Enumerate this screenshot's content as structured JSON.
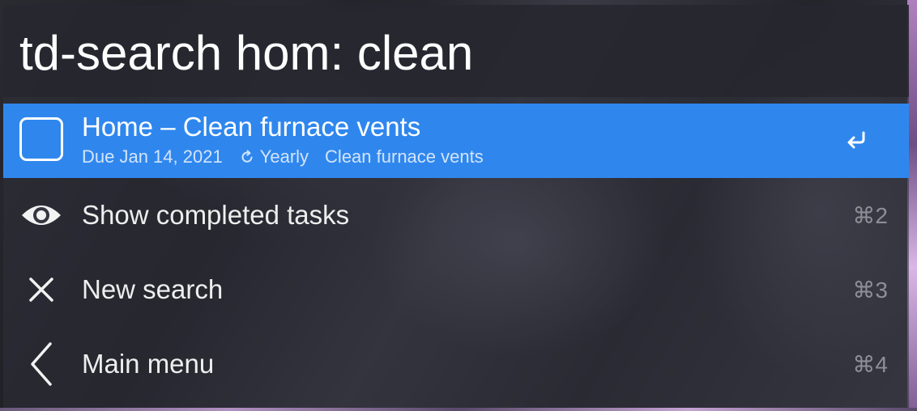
{
  "search": {
    "query": "td-search hom: clean"
  },
  "results": [
    {
      "title": "Home – Clean furnace vents",
      "due": "Due Jan 14, 2021",
      "recurrence": "Yearly",
      "note": "Clean furnace vents",
      "icon": "checkbox-icon",
      "action_icon": "return-icon"
    },
    {
      "label": "Show completed tasks",
      "shortcut": "⌘2",
      "icon": "eye-icon"
    },
    {
      "label": "New search",
      "shortcut": "⌘3",
      "icon": "close-icon"
    },
    {
      "label": "Main menu",
      "shortcut": "⌘4",
      "icon": "chevron-left-icon"
    }
  ],
  "colors": {
    "selection": "#2f87ee",
    "text": "#ffffff",
    "shortcut": "#8e8e96"
  }
}
